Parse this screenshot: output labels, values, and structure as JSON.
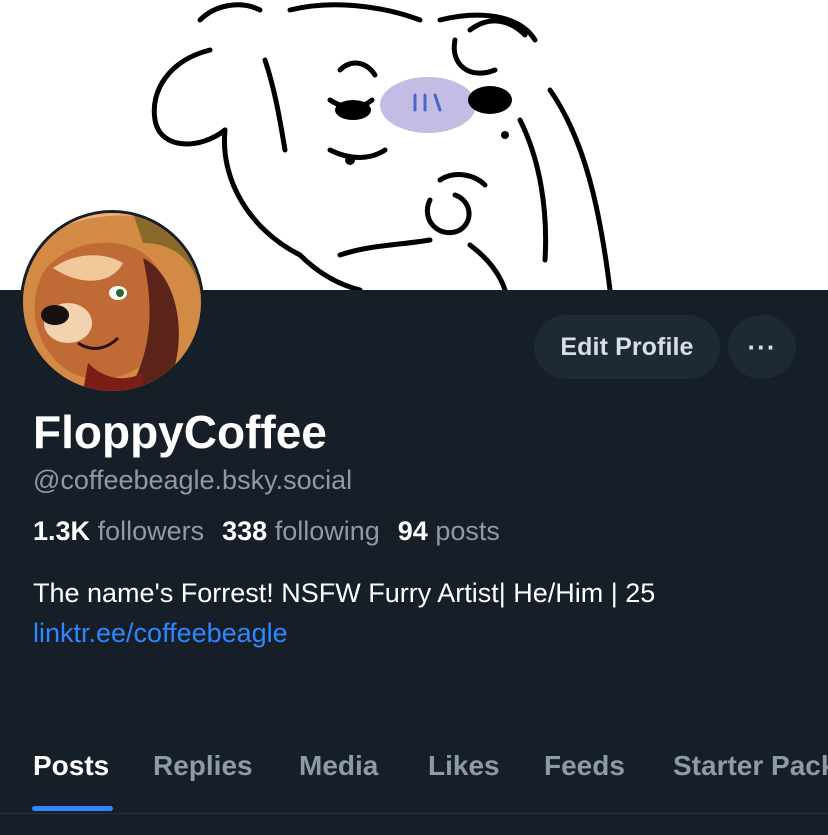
{
  "banner": {
    "icon": "cartoon-dog-drawing"
  },
  "avatar": {
    "icon": "beagle-avatar"
  },
  "actions": {
    "edit_label": "Edit Profile",
    "more_label": "···"
  },
  "profile": {
    "display_name": "FloppyCoffee",
    "handle": "@coffeebeagle.bsky.social",
    "followers_count": "1.3K",
    "followers_label": "followers",
    "following_count": "338",
    "following_label": "following",
    "posts_count": "94",
    "posts_label": "posts",
    "bio": "The name's Forrest! NSFW Furry Artist| He/Him | 25",
    "link": "linktr.ee/coffeebeagle"
  },
  "tabs": [
    {
      "label": "Posts",
      "active": true
    },
    {
      "label": "Replies"
    },
    {
      "label": "Media"
    },
    {
      "label": "Likes"
    },
    {
      "label": "Feeds"
    },
    {
      "label": "Starter Packs"
    }
  ],
  "colors": {
    "background": "#161e27",
    "accent": "#2f86ff",
    "muted_text": "#8d9aa8",
    "button_bg": "#1e2936"
  }
}
